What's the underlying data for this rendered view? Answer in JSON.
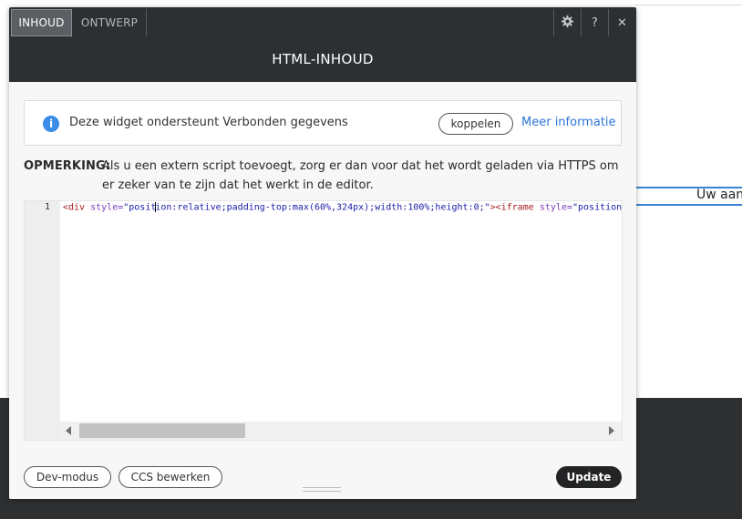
{
  "background": {
    "blue_field_text": "Uw aan"
  },
  "tabs": [
    {
      "label": "INHOUD",
      "active": true
    },
    {
      "label": "ONTWERP",
      "active": false
    }
  ],
  "window_controls": {
    "settings_icon": "gear-icon",
    "help_label": "?",
    "close_label": "✕"
  },
  "header": {
    "title": "HTML-INHOUD"
  },
  "info": {
    "icon_label": "i",
    "text": "Deze widget ondersteunt Verbonden gegevens",
    "connect_button": "koppelen",
    "more_link": "Meer informatie"
  },
  "note": {
    "label": "OPMERKING:",
    "text": "Als u een extern script toevoegt, zorg er dan voor dat het wordt geladen via HTTPS om er zeker van te zijn dat het werkt in de editor."
  },
  "editor": {
    "line_number": "1",
    "code": {
      "open_tag": "<div",
      "style_attr": "style=",
      "style_value_pre_cursor": "\"posit",
      "style_value_post_cursor": "ion:relative;padding-top:max(60%,324px);width:100%;height:0;\"",
      "close_bracket": ">",
      "iframe_tag": "<iframe",
      "iframe_style_attr": "style=",
      "iframe_style_value": "\"position"
    }
  },
  "footer": {
    "dev_button": "Dev-modus",
    "css_button": "CCS bewerken",
    "update_button": "Update"
  },
  "colors": {
    "dark": "#2d3033",
    "accent_blue": "#2b74d8",
    "info_icon": "#3b8ce8"
  }
}
